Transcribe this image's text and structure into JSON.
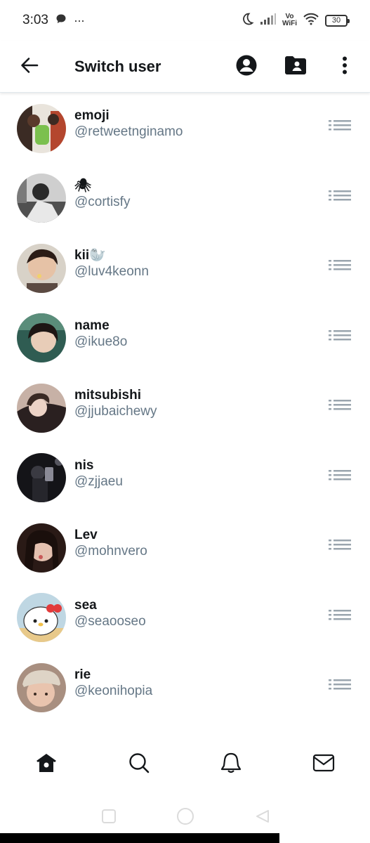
{
  "status_bar": {
    "time": "3:03",
    "more": "···",
    "network_line1": "Vo",
    "network_line2": "WiFi",
    "battery": "30"
  },
  "header": {
    "title": "Switch user",
    "icons": [
      "back-arrow-icon",
      "account-circle-icon",
      "folder-account-icon",
      "more-vertical-icon"
    ]
  },
  "users": [
    {
      "name": "emoji",
      "handle": "@retweetnginamo",
      "avatar_color": "#b85a3c"
    },
    {
      "name": "🕷",
      "handle": "@cortisfy",
      "avatar_color": "#6a6a6a"
    },
    {
      "name": "kii🦭",
      "handle": "@luv4keonn",
      "avatar_color": "#7d5d4a"
    },
    {
      "name": "name",
      "handle": "@ikue8o",
      "avatar_color": "#3d6b5e"
    },
    {
      "name": "mitsubishi",
      "handle": "@jjubaichewy",
      "avatar_color": "#8c6f63"
    },
    {
      "name": "nis",
      "handle": "@zjjaeu",
      "avatar_color": "#1c1c22"
    },
    {
      "name": "Lev",
      "handle": "@mohnvero",
      "avatar_color": "#3a2520"
    },
    {
      "name": "sea",
      "handle": "@seaooseo",
      "avatar_color": "#c9dde6"
    },
    {
      "name": "rie",
      "handle": "@keonihopia",
      "avatar_color": "#b18a77"
    }
  ],
  "bottom_nav": [
    "home-icon",
    "search-icon",
    "notifications-icon",
    "messages-icon"
  ],
  "colors": {
    "text_primary": "#14171a",
    "text_secondary": "#657786",
    "divider": "#e1e8ed"
  }
}
